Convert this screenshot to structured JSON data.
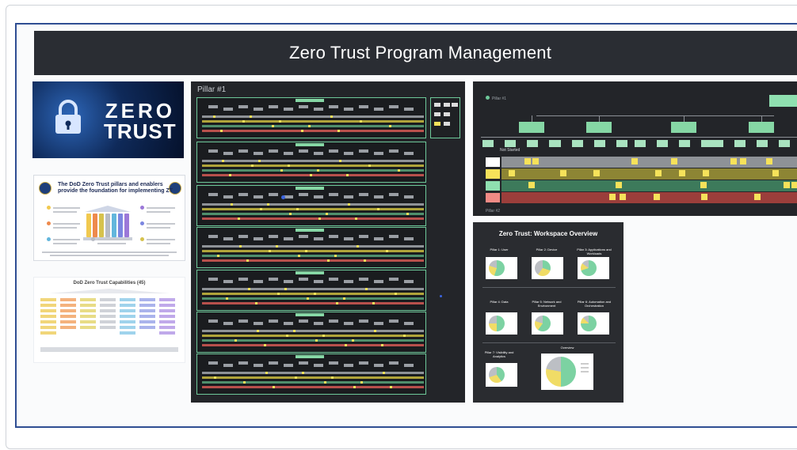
{
  "header": {
    "title": "Zero Trust Program Management"
  },
  "banner": {
    "line1": "ZERO",
    "line2": "TRUST"
  },
  "dod_pillars": {
    "title": "The DoD Zero Trust pillars and enablers provide the foundation for implementing ZT"
  },
  "dod_capabilities": {
    "title": "DoD Zero Trust Capabilities (45)"
  },
  "pillar1": {
    "label": "Pillar #1"
  },
  "pillar2": {
    "label": "Pillar #1",
    "footer_label": "Pillar #2",
    "status_label": "Not Started"
  },
  "workspace": {
    "title": "Zero Trust: Workspace Overview",
    "cells": [
      "Pillar 1: User",
      "Pillar 2: Device",
      "Pillar 3: Applications and Workloads",
      "Pillar 4: Data",
      "Pillar 5: Network and Environment",
      "Pillar 6: Automation and Orchestration",
      "Pillar 7: Visibility and Analytics",
      "Overview"
    ]
  },
  "colors": {
    "header_bg": "#2a2d33",
    "frame_border": "#2f4e93",
    "board_bg": "#232529",
    "accent_green": "#6ec99a",
    "sticky_yellow": "#f6e25a"
  }
}
